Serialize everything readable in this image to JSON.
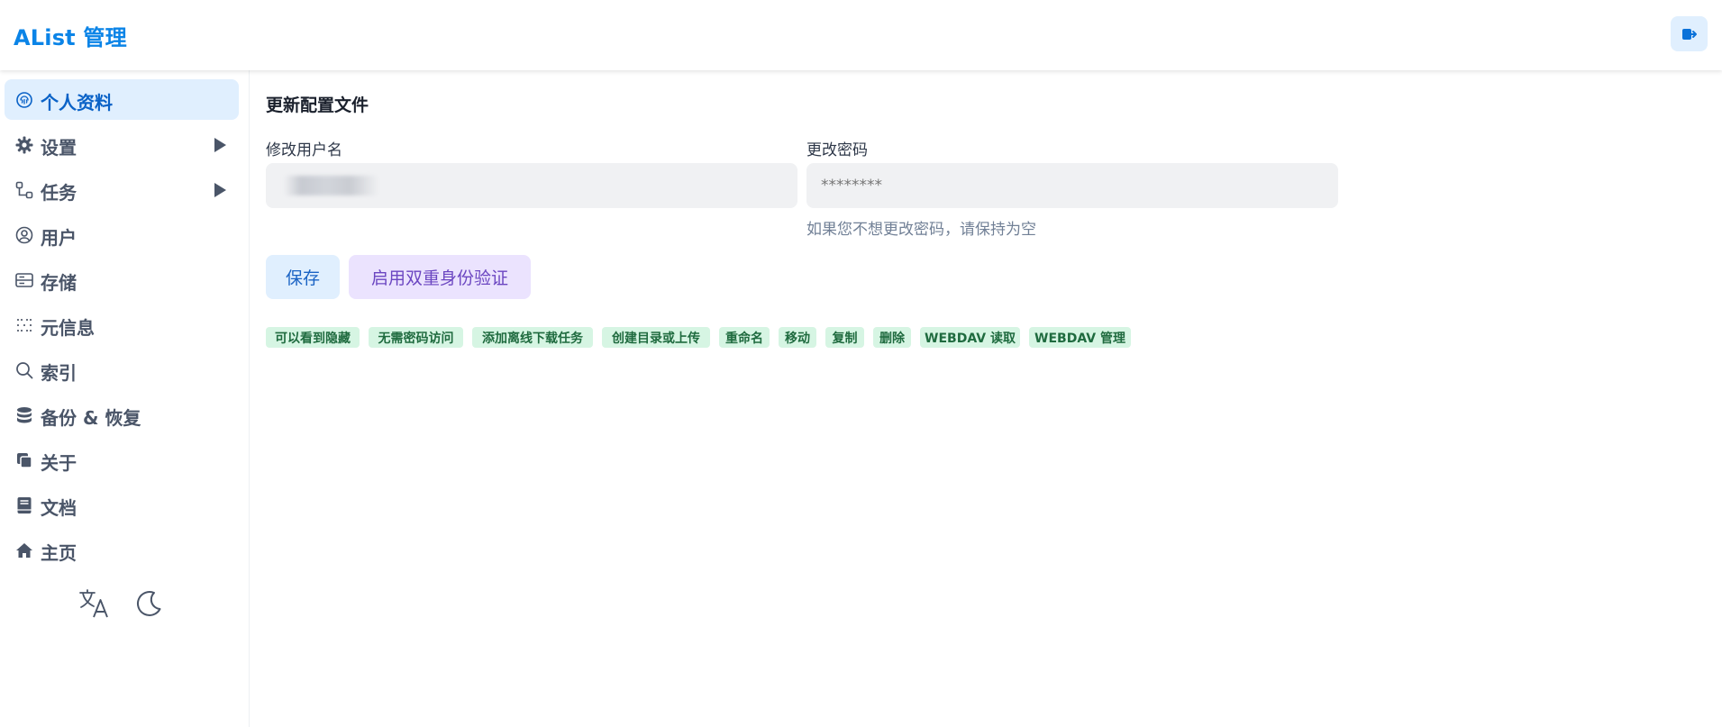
{
  "app": {
    "title": "AList 管理"
  },
  "sidebar": {
    "items": [
      {
        "label": "个人资料",
        "icon": "fingerprint-icon",
        "active": true
      },
      {
        "label": "设置",
        "icon": "gear-icon",
        "expandable": true
      },
      {
        "label": "任务",
        "icon": "workflow-icon",
        "expandable": true
      },
      {
        "label": "用户",
        "icon": "user-circle-icon"
      },
      {
        "label": "存储",
        "icon": "storage-icon"
      },
      {
        "label": "元信息",
        "icon": "metadata-icon"
      },
      {
        "label": "索引",
        "icon": "search-icon"
      },
      {
        "label": "备份 & 恢复",
        "icon": "database-icon"
      },
      {
        "label": "关于",
        "icon": "copy-icon"
      },
      {
        "label": "文档",
        "icon": "book-icon"
      },
      {
        "label": "主页",
        "icon": "home-icon"
      }
    ],
    "utilities": [
      "translate-icon",
      "moon-icon"
    ]
  },
  "main": {
    "section_title": "更新配置文件",
    "username": {
      "label": "修改用户名",
      "value": ""
    },
    "password": {
      "label": "更改密码",
      "placeholder": "********",
      "helper": "如果您不想更改密码，请保持为空"
    },
    "buttons": {
      "save": "保存",
      "enable_2fa": "启用双重身份验证"
    },
    "permissions": [
      "可以看到隐藏",
      "无需密码访问",
      "添加离线下载任务",
      "创建目录或上传",
      "重命名",
      "移动",
      "复制",
      "删除",
      "WEBDAV 读取",
      "WEBDAV 管理"
    ]
  },
  "colors": {
    "accent": "#0b84e7",
    "active_bg": "#e0effe",
    "tag_bg": "#d6f5e3",
    "tag_text": "#1f6b3f",
    "purple_btn_bg": "#ebe3fe",
    "purple_btn_text": "#6b46c1"
  }
}
